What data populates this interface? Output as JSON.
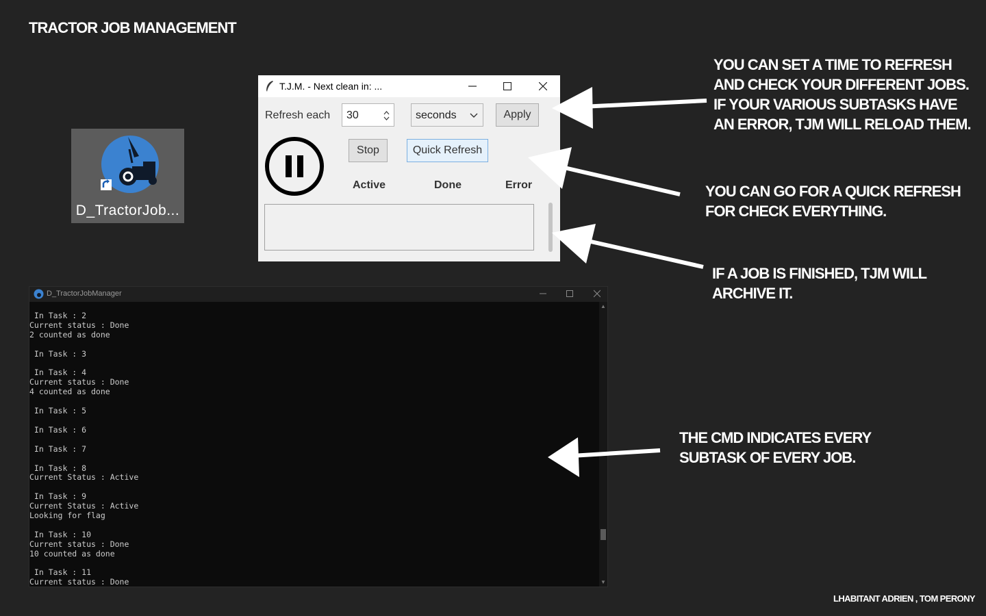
{
  "page": {
    "title": "TRACTOR JOB MANAGEMENT",
    "credit": "LHABITANT ADRIEN , TOM PERONY"
  },
  "desktop_icon": {
    "label": "D_TractorJob..."
  },
  "tjm_window": {
    "title": "T.J.M. - Next clean in: ...",
    "refresh_label": "Refresh each",
    "refresh_value": "30",
    "unit_selected": "seconds",
    "apply_label": "Apply",
    "stop_label": "Stop",
    "quick_refresh_label": "Quick Refresh",
    "columns": [
      "Active",
      "Done",
      "Error"
    ]
  },
  "console": {
    "title": "D_TractorJobManager",
    "lines": [
      " In Task : 2",
      "Current status : Done",
      "2 counted as done",
      "",
      " In Task : 3",
      "",
      " In Task : 4",
      "Current status : Done",
      "4 counted as done",
      "",
      " In Task : 5",
      "",
      " In Task : 6",
      "",
      " In Task : 7",
      "",
      " In Task : 8",
      "Current Status : Active",
      "",
      " In Task : 9",
      "Current Status : Active",
      "Looking for flag",
      "",
      " In Task : 10",
      "Current status : Done",
      "10 counted as done",
      "",
      " In Task : 11",
      "Current status : Done"
    ]
  },
  "annotations": {
    "refresh_note": [
      "YOU CAN SET A TIME TO REFRESH",
      "AND CHECK YOUR DIFFERENT JOBS.",
      "IF YOUR VARIOUS SUBTASKS HAVE",
      "AN ERROR, TJM WILL RELOAD THEM."
    ],
    "quick_refresh_note": [
      "YOU CAN GO FOR A QUICK REFRESH",
      "FOR CHECK EVERYTHING."
    ],
    "archive_note": [
      "IF A JOB IS FINISHED, TJM WILL",
      "ARCHIVE IT."
    ],
    "cmd_note": [
      "THE CMD INDICATES EVERY",
      "SUBTASK OF EVERY JOB."
    ]
  },
  "colors": {
    "background": "#232323",
    "logo_blue": "#3b82d0",
    "console_bg": "#0c0c0c",
    "quick_refresh_border": "#7aaee0"
  }
}
